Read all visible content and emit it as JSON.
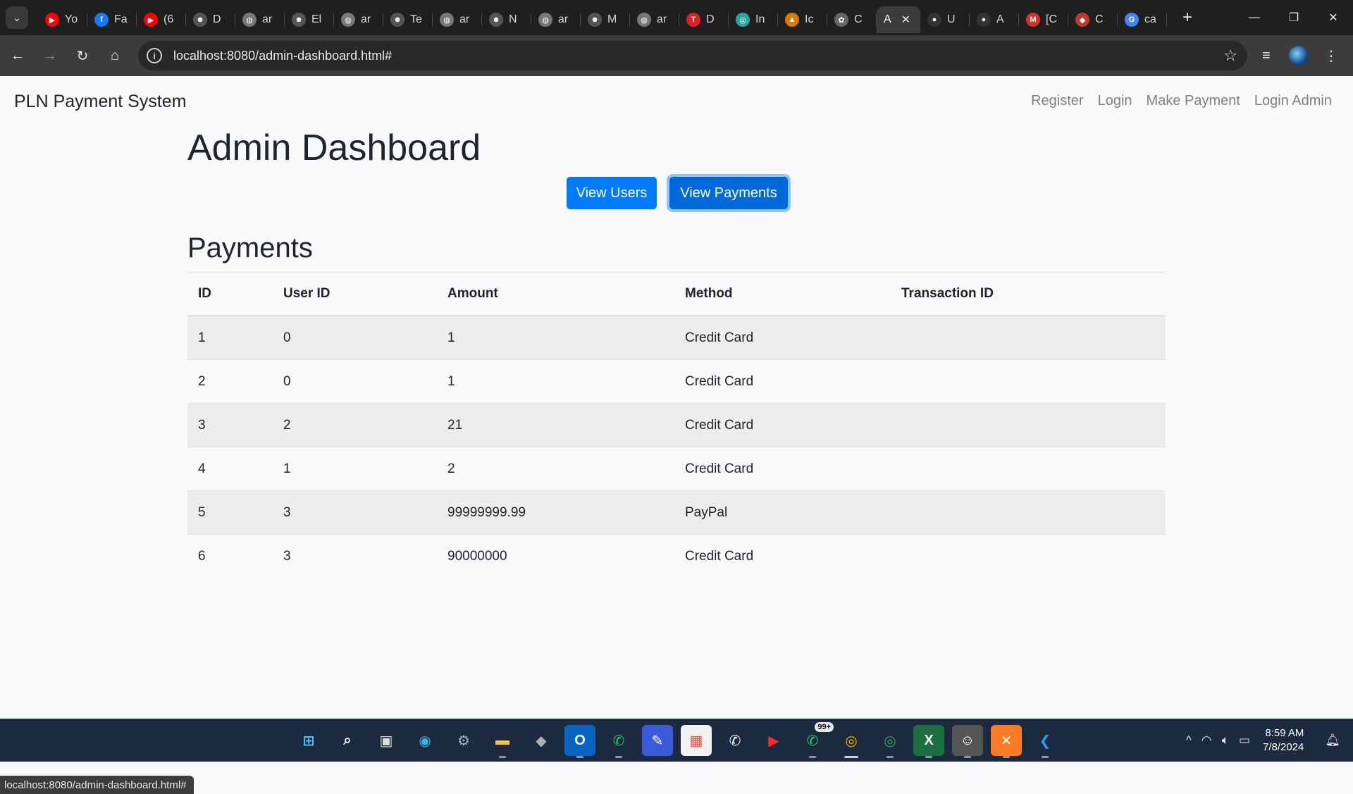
{
  "browser": {
    "tabs": [
      {
        "icon": "youtube-icon",
        "label": "Yo",
        "color": "#ff0000",
        "glyph": "▶"
      },
      {
        "icon": "facebook-icon",
        "label": "Fa",
        "color": "#1877f2",
        "glyph": "f"
      },
      {
        "icon": "youtube-icon",
        "label": "(6",
        "color": "#ff0000",
        "glyph": "▶"
      },
      {
        "icon": "ninja-icon",
        "label": "D",
        "color": "#555555",
        "glyph": "☻"
      },
      {
        "icon": "globe-icon",
        "label": "ar",
        "color": "#777777",
        "glyph": "◍"
      },
      {
        "icon": "ninja-icon",
        "label": "El",
        "color": "#555555",
        "glyph": "☻"
      },
      {
        "icon": "globe-icon",
        "label": "ar",
        "color": "#777777",
        "glyph": "◍"
      },
      {
        "icon": "ninja-icon",
        "label": "Te",
        "color": "#555555",
        "glyph": "☻"
      },
      {
        "icon": "globe-icon",
        "label": "ar",
        "color": "#777777",
        "glyph": "◍"
      },
      {
        "icon": "ninja-icon",
        "label": "N",
        "color": "#555555",
        "glyph": "☻"
      },
      {
        "icon": "globe-icon",
        "label": "ar",
        "color": "#777777",
        "glyph": "◍"
      },
      {
        "icon": "ninja-icon",
        "label": "M",
        "color": "#555555",
        "glyph": "☻"
      },
      {
        "icon": "globe-icon",
        "label": "ar",
        "color": "#777777",
        "glyph": "◍"
      },
      {
        "icon": "t-logo-icon",
        "label": "D",
        "color": "#e01e25",
        "glyph": "T"
      },
      {
        "icon": "swirl-icon",
        "label": "In",
        "color": "#2aa6a0",
        "glyph": "◎"
      },
      {
        "icon": "mountain-icon",
        "label": "Ic",
        "color": "#d97b00",
        "glyph": "▲"
      },
      {
        "icon": "chatgpt-icon",
        "label": "C",
        "color": "#666666",
        "glyph": "✿"
      },
      {
        "icon": "none",
        "label": "A",
        "color": "#3c3c3c",
        "glyph": ""
      },
      {
        "icon": "github-icon",
        "label": "U",
        "color": "#333333",
        "glyph": "●"
      },
      {
        "icon": "github-icon",
        "label": "A",
        "color": "#333333",
        "glyph": "●"
      },
      {
        "icon": "gmail-icon",
        "label": "[C",
        "color": "#d93025",
        "glyph": "M"
      },
      {
        "icon": "leaf-icon",
        "label": "C",
        "color": "#c0392b",
        "glyph": "◆"
      },
      {
        "icon": "google-icon",
        "label": "ca",
        "color": "#4285f4",
        "glyph": "G"
      }
    ],
    "active_tab_index": 17,
    "url": "localhost:8080/admin-dashboard.html#",
    "status_url": "localhost:8080/admin-dashboard.html#"
  },
  "navbar": {
    "brand": "PLN Payment System",
    "links": [
      "Register",
      "Login",
      "Make Payment",
      "Login Admin"
    ]
  },
  "main": {
    "title": "Admin Dashboard",
    "buttons": {
      "view_users": "View Users",
      "view_payments": "View Payments"
    },
    "section_title": "Payments",
    "table": {
      "headers": [
        "ID",
        "User ID",
        "Amount",
        "Method",
        "Transaction ID"
      ],
      "rows": [
        [
          "1",
          "0",
          "1",
          "Credit Card",
          ""
        ],
        [
          "2",
          "0",
          "1",
          "Credit Card",
          ""
        ],
        [
          "3",
          "2",
          "21",
          "Credit Card",
          ""
        ],
        [
          "4",
          "1",
          "2",
          "Credit Card",
          ""
        ],
        [
          "5",
          "3",
          "99999999.99",
          "PayPal",
          ""
        ],
        [
          "6",
          "3",
          "90000000",
          "Credit Card",
          ""
        ]
      ]
    }
  },
  "colors": {
    "primary": "#007bff",
    "primary_active": "#0069d9",
    "stripe": "#ececec"
  },
  "taskbar": {
    "apps": [
      {
        "name": "windows-start-icon",
        "glyph": "⊞",
        "bg": "#1c2a40",
        "fg": "#4cc2ff"
      },
      {
        "name": "search-icon",
        "glyph": "⌕",
        "bg": "#1c2a40",
        "fg": "#ffffff"
      },
      {
        "name": "task-view-icon",
        "glyph": "▣",
        "bg": "#1c2a40",
        "fg": "#dddddd"
      },
      {
        "name": "edge-icon",
        "glyph": "◉",
        "bg": "#1c2a40",
        "fg": "#2fb5e8"
      },
      {
        "name": "settings-icon",
        "glyph": "⚙",
        "bg": "#1c2a40",
        "fg": "#9fb3c8"
      },
      {
        "name": "file-explorer-icon",
        "glyph": "▬",
        "bg": "#1c2a40",
        "fg": "#f5c542"
      },
      {
        "name": "app-cube-icon",
        "glyph": "◆",
        "bg": "#1c2a40",
        "fg": "#b0b0b0"
      },
      {
        "name": "outlook-icon",
        "glyph": "O",
        "bg": "#0a64c2",
        "fg": "#ffffff"
      },
      {
        "name": "whatsapp-icon",
        "glyph": "✆",
        "bg": "#1c2a40",
        "fg": "#25d366"
      },
      {
        "name": "pen-app-icon",
        "glyph": "✎",
        "bg": "#3b5bdb",
        "fg": "#ffffff"
      },
      {
        "name": "store-icon",
        "glyph": "▦",
        "bg": "#f1f1f1",
        "fg": "#e74c3c"
      },
      {
        "name": "whatsapp-circle-icon",
        "glyph": "✆",
        "bg": "#1c2a40",
        "fg": "#ffffff"
      },
      {
        "name": "youtube-music-icon",
        "glyph": "▶",
        "bg": "#1c2a40",
        "fg": "#ff2b2b"
      },
      {
        "name": "whatsapp-badge-icon",
        "glyph": "✆",
        "bg": "#1c2a40",
        "fg": "#25d366",
        "badge": "99+"
      },
      {
        "name": "chrome-icon",
        "glyph": "◎",
        "bg": "#1c2a40",
        "fg": "#f4b400"
      },
      {
        "name": "chrome-alt-icon",
        "glyph": "◎",
        "bg": "#1c2a40",
        "fg": "#34a853"
      },
      {
        "name": "excel-icon",
        "glyph": "X",
        "bg": "#1d6f42",
        "fg": "#ffffff"
      },
      {
        "name": "avatar-app-icon",
        "glyph": "☺",
        "bg": "#555555",
        "fg": "#ffffff"
      },
      {
        "name": "xampp-icon",
        "glyph": "✕",
        "bg": "#fb7a24",
        "fg": "#ffffff"
      },
      {
        "name": "vscode-icon",
        "glyph": "❮",
        "bg": "#1c2a40",
        "fg": "#2c9cf0"
      }
    ],
    "time": "8:59 AM",
    "date": "7/8/2024"
  }
}
